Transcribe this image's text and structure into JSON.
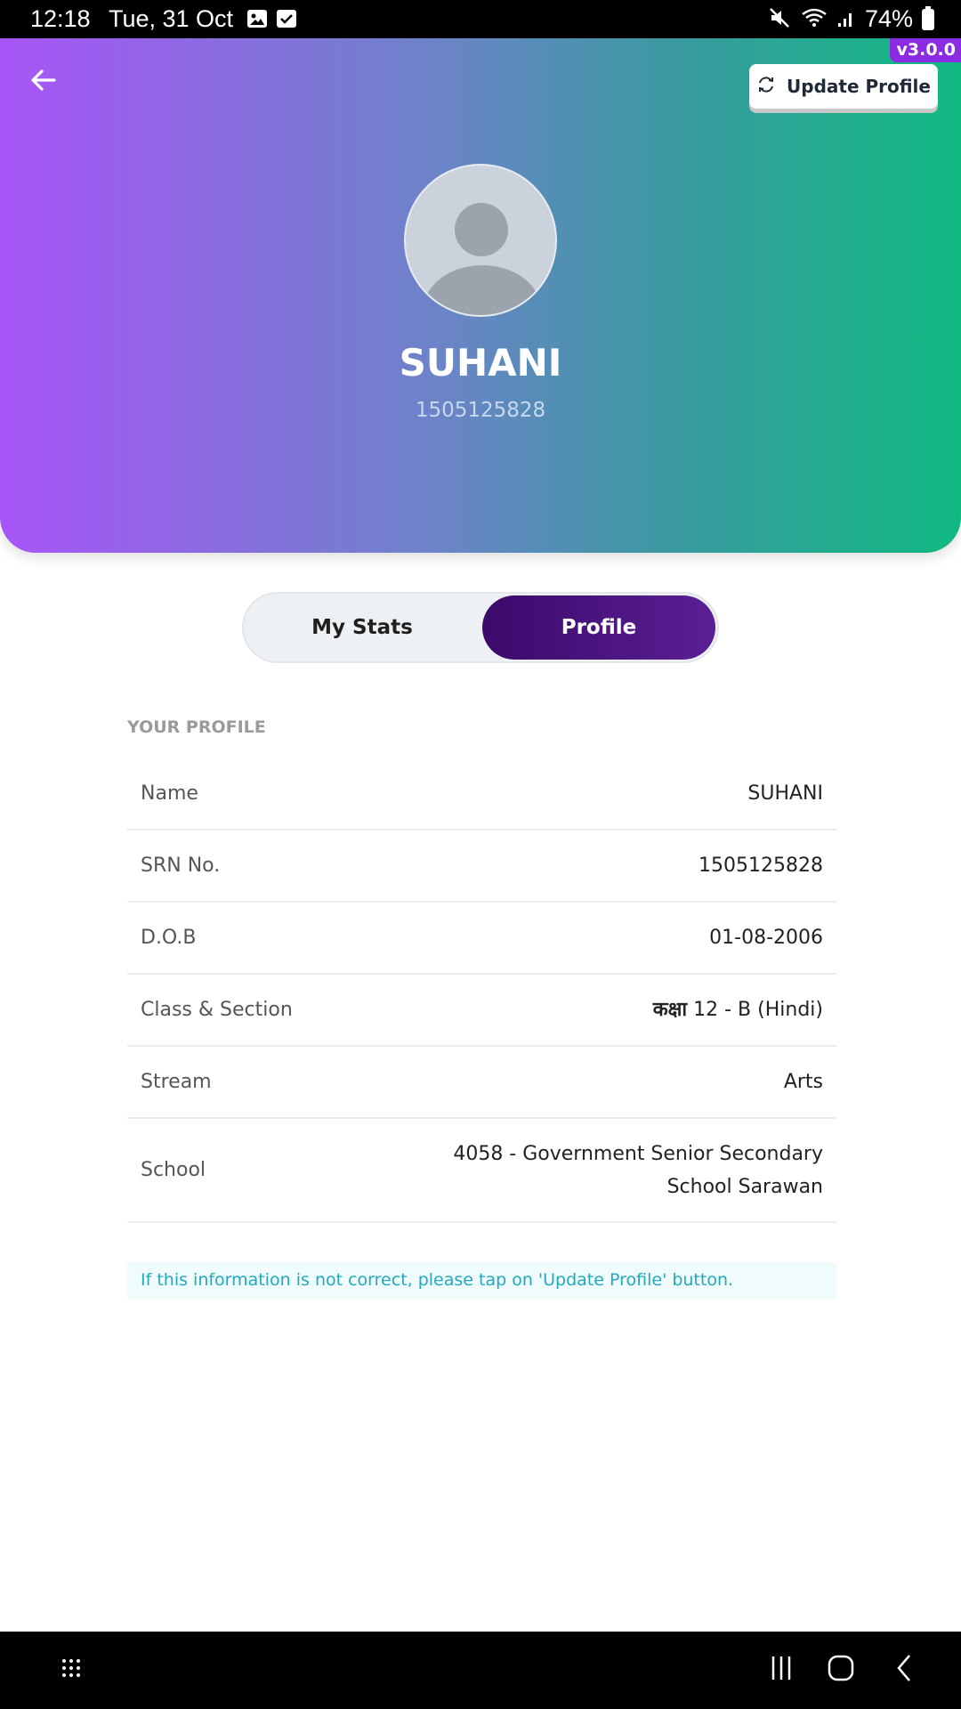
{
  "status_bar": {
    "time": "12:18",
    "date": "Tue, 31 Oct",
    "battery": "74%",
    "icons": [
      "gallery-notification-icon",
      "checkbox-notification-icon",
      "mute-icon",
      "wifi-icon",
      "signal-icon",
      "battery-icon"
    ]
  },
  "header": {
    "version": "v3.0.0",
    "update_button_label": "Update Profile",
    "student_name": "SUHANI",
    "srn": "1505125828",
    "gradient": [
      "#a855f7",
      "#10b981"
    ]
  },
  "tabs": [
    {
      "label": "My Stats",
      "active": false
    },
    {
      "label": "Profile",
      "active": true
    }
  ],
  "profile": {
    "section_title": "YOUR PROFILE",
    "rows": [
      {
        "label": "Name",
        "value": "SUHANI"
      },
      {
        "label": "SRN No.",
        "value": "1505125828"
      },
      {
        "label": "D.O.B",
        "value": "01-08-2006"
      },
      {
        "label": "Class & Section",
        "value_prefix": "कक्षा",
        "value": "12 - B (Hindi)"
      },
      {
        "label": "Stream",
        "value": "Arts"
      },
      {
        "label": "School",
        "value": "4058 - Government Senior Secondary School Sarawan"
      }
    ],
    "note": "If this information is not correct, please tap on 'Update Profile' button."
  },
  "colors": {
    "active_tab": "#3b0a6b",
    "note_text": "#22a9bf",
    "version_badge": "#8b2be2"
  }
}
